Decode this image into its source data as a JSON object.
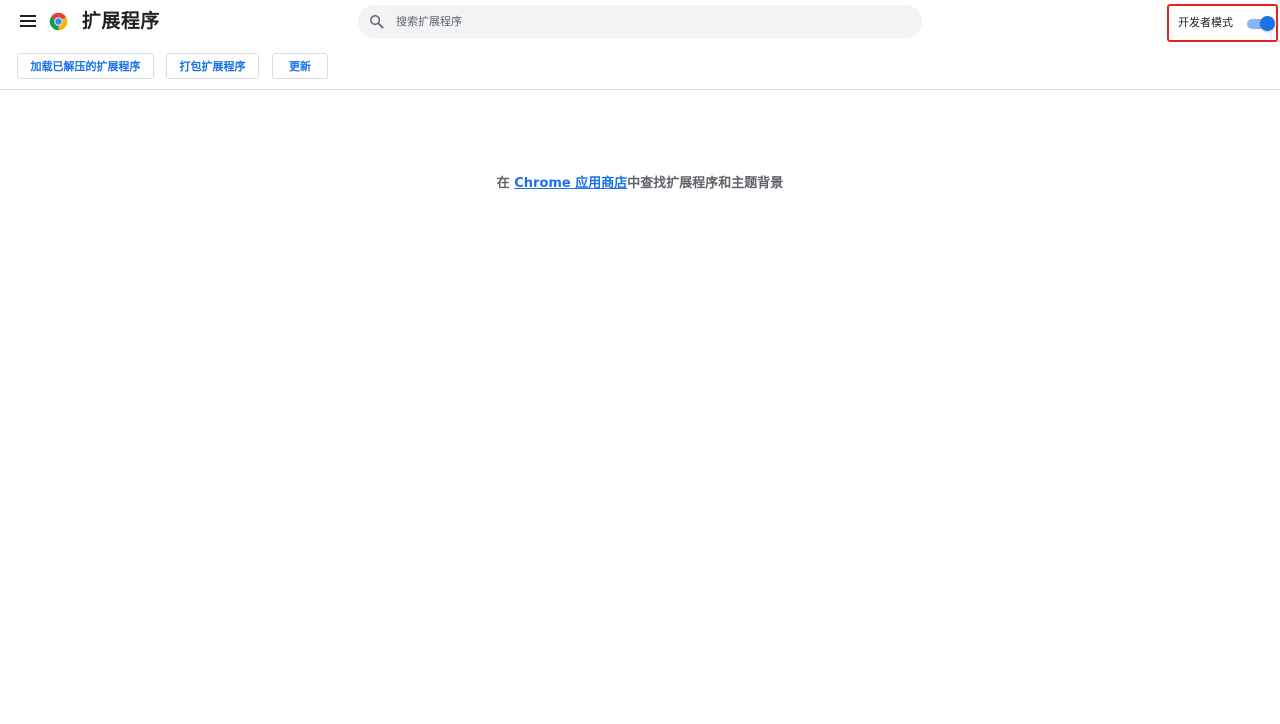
{
  "header": {
    "menu_icon": "hamburger-menu-icon",
    "logo_icon": "chrome-logo-icon",
    "title": "扩展程序",
    "search": {
      "placeholder": "搜索扩展程序",
      "value": "",
      "icon": "search-icon"
    },
    "developer_mode": {
      "label": "开发者模式",
      "enabled": true
    }
  },
  "toolbar": {
    "load_unpacked_label": "加载已解压的扩展程序",
    "pack_label": "打包扩展程序",
    "update_label": "更新"
  },
  "main": {
    "empty_prefix": "在 ",
    "store_link_text": "Chrome 应用商店",
    "empty_suffix": "中查找扩展程序和主题背景"
  },
  "colors": {
    "accent": "#1a73e8",
    "toggle_track": "#8ab4f8",
    "highlight_border": "#e8231f",
    "search_bg": "#f1f3f4"
  }
}
